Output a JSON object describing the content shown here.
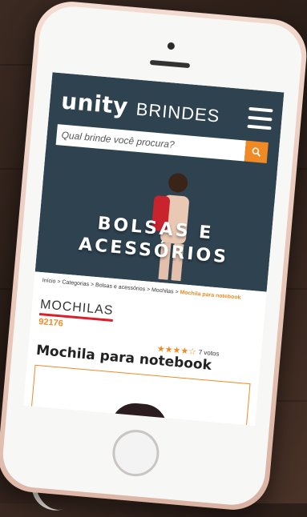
{
  "header": {
    "logo": "unity",
    "logo_sub": "BRINDES",
    "search_placeholder": "Qual brinde você procura?"
  },
  "banner": {
    "line1": "BOLSAS E",
    "line2": "ACESSÓRIOS"
  },
  "breadcrumb": {
    "path": "Início > Categorias > Bolsas e acessórios > Mochilas >",
    "current": "Mochila para notebook"
  },
  "product": {
    "category": "MOCHILAS",
    "code": "92176",
    "stars": "★★★★☆",
    "votes": "7 votos",
    "title": "Mochila para notebook"
  },
  "colors": {
    "header_bg": "#2f4250",
    "accent": "#f08a24",
    "underline": "#d81f2a"
  },
  "icons": {
    "menu": "hamburger-icon",
    "search": "search-icon"
  }
}
